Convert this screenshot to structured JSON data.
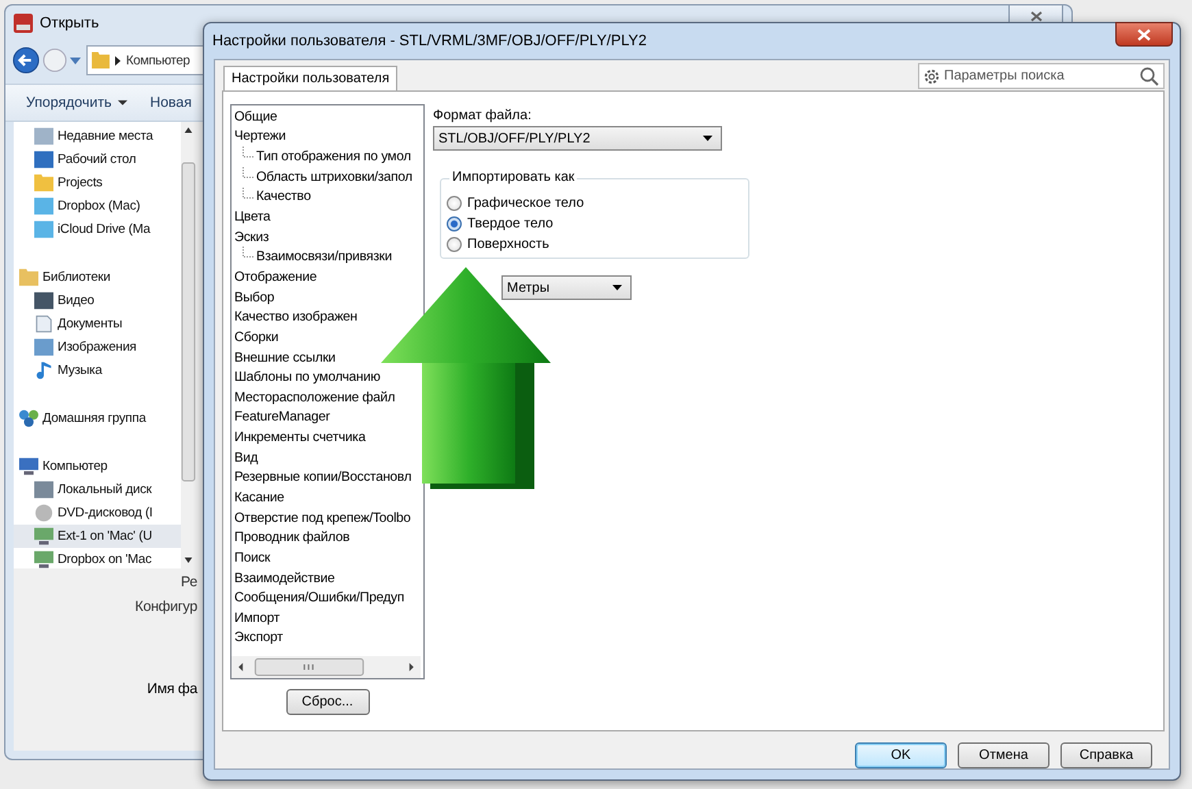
{
  "back_window": {
    "title": "Открыть",
    "address": "Компьютер",
    "toolbar": [
      {
        "label": "Упорядочить",
        "dropdown": true
      },
      {
        "label": "Новая",
        "dropdown": false
      }
    ],
    "navigation": [
      {
        "children": [
          {
            "label": "Недавние места",
            "kind": "recent",
            "selected": false
          },
          {
            "label": "Рабочий стол",
            "kind": "desktop",
            "selected": false
          },
          {
            "label": "Projects",
            "kind": "folder",
            "selected": false
          },
          {
            "label": "Dropbox (Mac)",
            "kind": "cloud",
            "selected": false
          },
          {
            "label": "iCloud Drive (Ma",
            "kind": "cloud",
            "selected": false
          }
        ]
      },
      {
        "label": "Библиотеки",
        "kind": "library",
        "selected": false,
        "children": [
          {
            "label": "Видео",
            "kind": "video",
            "selected": false
          },
          {
            "label": "Документы",
            "kind": "document",
            "selected": false
          },
          {
            "label": "Изображения",
            "kind": "image",
            "selected": false
          },
          {
            "label": "Музыка",
            "kind": "music",
            "selected": false
          }
        ]
      },
      {
        "label": "Домашняя группа",
        "kind": "homegroup",
        "selected": false
      },
      {
        "label": "Компьютер",
        "kind": "computer",
        "selected": false,
        "children": [
          {
            "label": "Локальный диск",
            "kind": "disk",
            "selected": false
          },
          {
            "label": "DVD-дисковод (I",
            "kind": "dvd",
            "selected": false
          },
          {
            "label": "Ext-1 on 'Mac' (U",
            "kind": "netdrive",
            "selected": true
          },
          {
            "label": "Dropbox on 'Mac",
            "kind": "netdrive",
            "selected": false
          }
        ]
      }
    ],
    "fields": [
      "Ре",
      "Конфигур",
      "Имя фа"
    ]
  },
  "dialog": {
    "title": "Настройки пользователя - STL/VRML/3MF/OBJ/OFF/PLY/PLY2",
    "tabs": [
      {
        "label": "Настройки пользователя",
        "selected": true
      }
    ],
    "search": {
      "placeholder": "Параметры поиска"
    },
    "tree": [
      {
        "label": "Общие"
      },
      {
        "label": "Чертежи",
        "children": [
          {
            "label": "Тип отображения по умол"
          },
          {
            "label": "Область штриховки/запол"
          },
          {
            "label": "Качество"
          }
        ]
      },
      {
        "label": "Цвета"
      },
      {
        "label": "Эскиз",
        "children": [
          {
            "label": "Взаимосвязи/привязки"
          }
        ]
      },
      {
        "label": "Отображение"
      },
      {
        "label": "Выбор"
      },
      {
        "label": "Качество изображен"
      },
      {
        "label": "Сборки"
      },
      {
        "label": "Внешние ссылки"
      },
      {
        "label": "Шаблоны по умолчанию"
      },
      {
        "label": "Месторасположение файл"
      },
      {
        "label": "FeatureManager"
      },
      {
        "label": "Инкременты счетчика"
      },
      {
        "label": "Вид"
      },
      {
        "label": "Резервные копии/Восстановл"
      },
      {
        "label": "Касание"
      },
      {
        "label": "Отверстие под крепеж/Toolbo"
      },
      {
        "label": "Проводник файлов"
      },
      {
        "label": "Поиск"
      },
      {
        "label": "Взаимодействие"
      },
      {
        "label": "Сообщения/Ошибки/Предуп"
      },
      {
        "label": "Импорт"
      },
      {
        "label": "Экспорт"
      }
    ],
    "reset_button": "Сброс...",
    "file_format": {
      "label": "Формат файла:",
      "value": "STL/OBJ/OFF/PLY/PLY2"
    },
    "import_as": {
      "label": "Импортировать как",
      "options": [
        {
          "label": "Графическое тело",
          "selected": false
        },
        {
          "label": "Твердое тело",
          "selected": true
        },
        {
          "label": "Поверхность",
          "selected": false
        }
      ]
    },
    "units": {
      "value": "Метры"
    },
    "buttons": [
      {
        "label": "OK",
        "default": true
      },
      {
        "label": "Отмена",
        "default": false
      },
      {
        "label": "Справка",
        "default": false
      }
    ]
  }
}
